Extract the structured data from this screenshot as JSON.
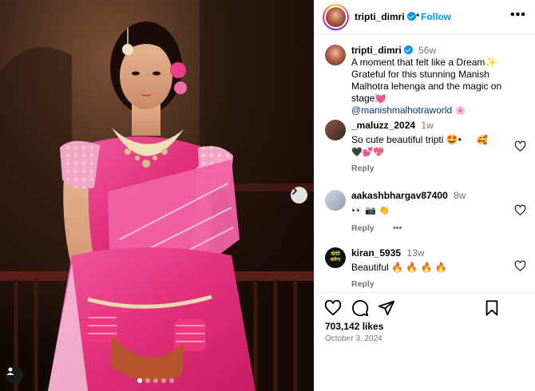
{
  "header": {
    "username": "tripti_dimri",
    "separator": "•",
    "follow_label": "Follow",
    "more_label": "•••"
  },
  "caption": {
    "username": "tripti_dimri",
    "time": "56w",
    "line1": "A moment that felt like a Dream✨",
    "line2": "Grateful for this stunning Manish Malhotra lehenga and the magic on stage💓",
    "mention": "@manishmalhotraworld",
    "mention_emoji": "🌸"
  },
  "comments": [
    {
      "username": "_maluzz_2024",
      "time": "1w",
      "text": "So cute beautiful tripti 🤩•",
      "emoji_tail": "🥰",
      "emoji_line2": "🖤💕💖",
      "reply_label": "Reply"
    },
    {
      "username": "aakashbhargav87400",
      "time": "8w",
      "text": "👀 📷 👏",
      "reply_label": "Reply",
      "more_label": "•••"
    },
    {
      "username": "kiran_5935",
      "time": "13w",
      "text": "Beautiful 🔥 🔥 🔥 🔥",
      "reply_label": "Reply",
      "avatar_text": "कीर्ति\nबलेगा"
    }
  ],
  "footer": {
    "likes": "703,142 likes",
    "date": "October 3, 2024"
  },
  "icons": {
    "like": "heart-icon",
    "comment": "comment-icon",
    "share": "share-icon",
    "save": "bookmark-icon",
    "next": "chevron-right-icon",
    "tag": "user-tag-icon"
  },
  "colors": {
    "accent": "#0095f6",
    "mention": "#00376b",
    "muted": "#737373",
    "lehenga": "#e2307a"
  },
  "media": {
    "slide_count": 5,
    "active_slide": 1
  }
}
